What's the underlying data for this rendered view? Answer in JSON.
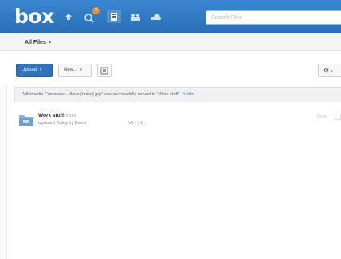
{
  "topbar": {
    "logo": "box",
    "notification_count": "3",
    "nav": [
      "inbox-icon",
      "notifications-icon",
      "files-icon",
      "people-icon",
      "cloud-icon"
    ],
    "search_placeholder": "Search Files",
    "colors": {
      "bar": "#2a6fb6",
      "badge": "#f08a24"
    }
  },
  "subbar": {
    "folder_label": "All Files",
    "caret": "▾"
  },
  "toolbar": {
    "upload_label": "Upload",
    "new_label": "New...",
    "caret": "▾",
    "settings_caret": "▾"
  },
  "notice": {
    "message": "\"Wikimedia Commons - Moon (noise).jpg\" was successfully moved to \"Work stuff\".",
    "undo_label": "Undo"
  },
  "items": [
    {
      "name": "Work stuff",
      "tag": "shared",
      "meta": "Updated Today by David",
      "version": "V1 · 1.0",
      "share_label": "Share",
      "icon": "folder-icon"
    }
  ]
}
